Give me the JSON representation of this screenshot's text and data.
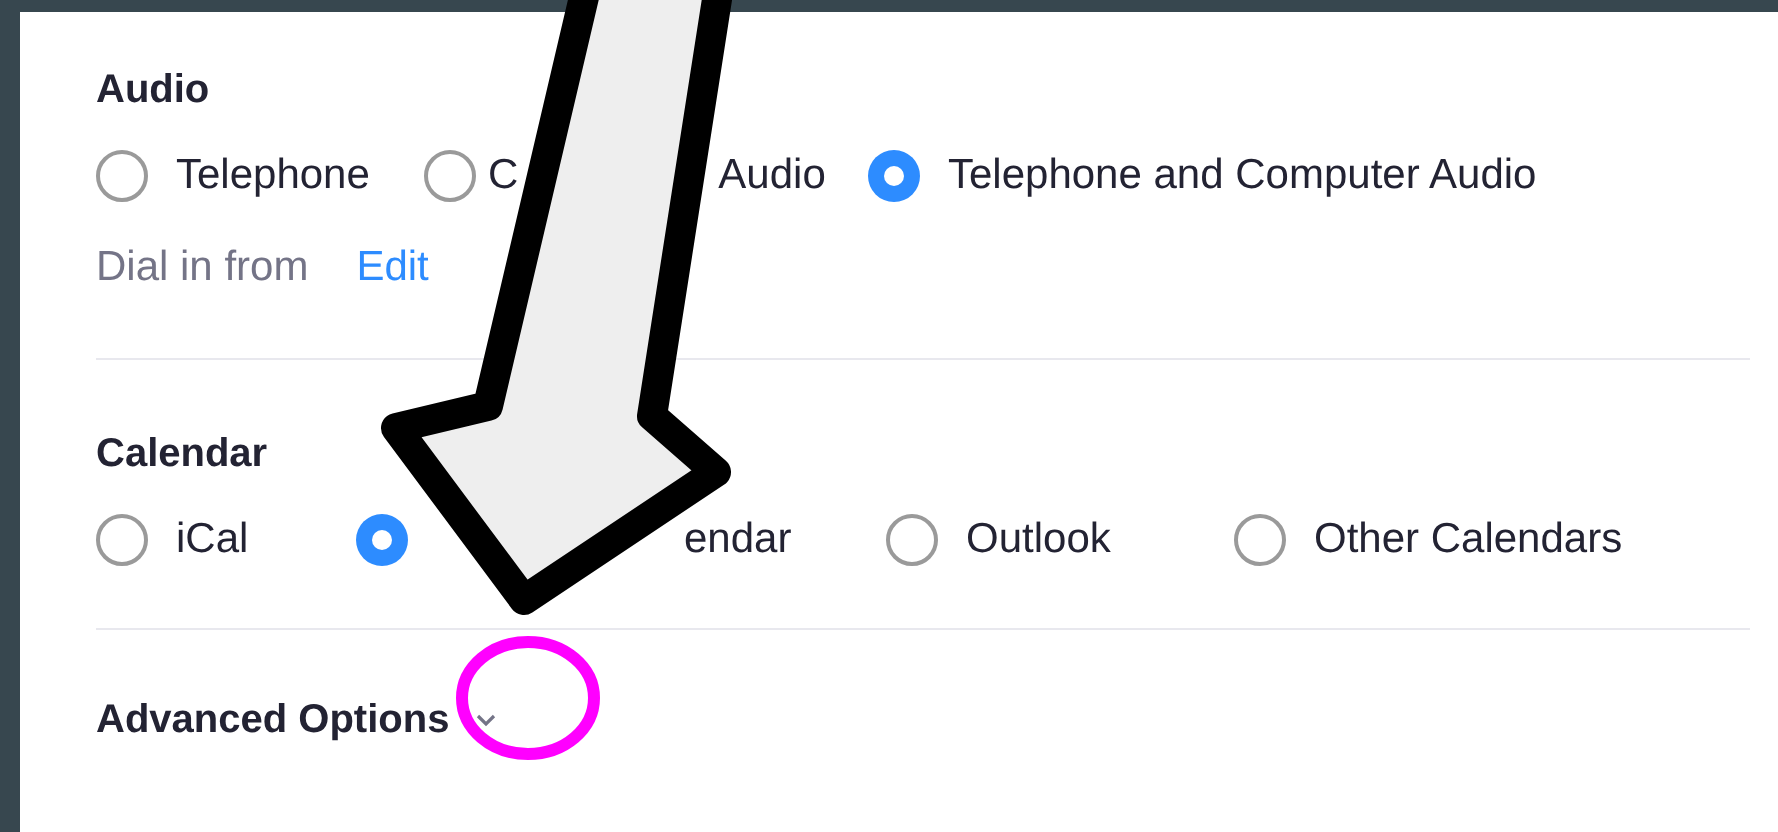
{
  "audio": {
    "title": "Audio",
    "options": [
      {
        "label_parts": [
          "Telephone"
        ],
        "selected": false
      },
      {
        "label_parts": [
          "C",
          "Audio"
        ],
        "selected": false
      },
      {
        "label_parts": [
          "Telephone and Computer Audio"
        ],
        "selected": true
      }
    ],
    "dial_in_label": "Dial in from",
    "edit_link": "Edit"
  },
  "calendar": {
    "title": "Calendar",
    "options": [
      {
        "label_parts": [
          "iCal"
        ],
        "selected": false
      },
      {
        "label_parts": [
          "endar"
        ],
        "selected": true
      },
      {
        "label_parts": [
          "Outlook"
        ],
        "selected": false
      },
      {
        "label_parts": [
          "Other Calendars"
        ],
        "selected": false
      }
    ]
  },
  "advanced": {
    "title": "Advanced Options",
    "expanded": false
  }
}
